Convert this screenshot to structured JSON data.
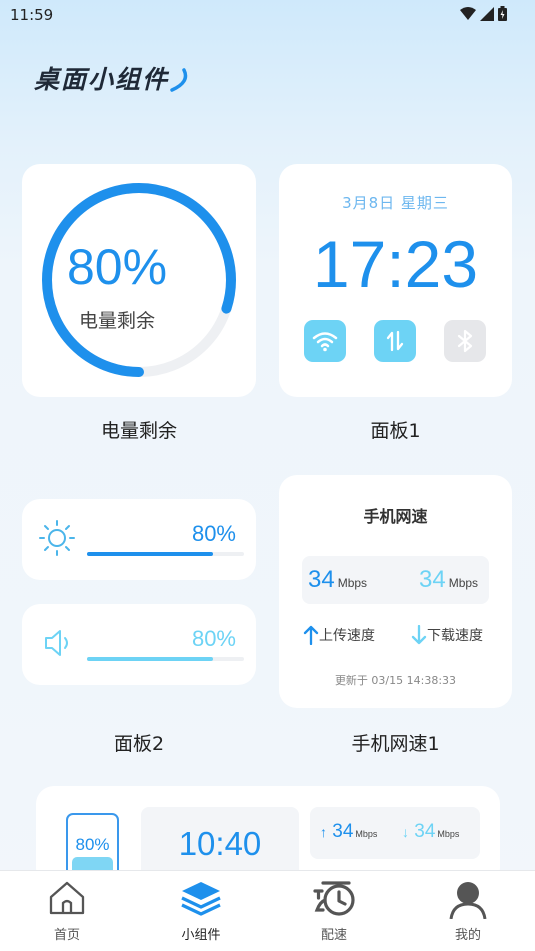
{
  "status_bar": {
    "time": "11:59"
  },
  "page": {
    "title": "桌面小组件"
  },
  "widgets": {
    "battery": {
      "percent_text": "80%",
      "percent_value": 80,
      "subtitle": "电量剩余",
      "caption": "电量剩余"
    },
    "panel1": {
      "date": "3月8日  星期三",
      "time": "17:23",
      "caption": "面板1"
    },
    "panel2": {
      "brightness": {
        "value_text": "80%",
        "level": 0.8
      },
      "volume": {
        "value_text": "80%",
        "level": 0.8
      },
      "caption": "面板2"
    },
    "network": {
      "title": "手机网速",
      "upload": {
        "value": "34",
        "unit": "Mbps",
        "label": "上传速度"
      },
      "download": {
        "value": "34",
        "unit": "Mbps",
        "label": "下载速度"
      },
      "updated": "更新于 03/15 14:38:33",
      "caption": "手机网速1"
    }
  },
  "preview": {
    "battery": "80%",
    "clock": "10:40",
    "upload": {
      "value": "34",
      "unit": "Mbps"
    },
    "download": {
      "value": "34",
      "unit": "Mbps"
    }
  },
  "nav": {
    "items": [
      {
        "label": "首页",
        "icon": "home-icon",
        "active": false
      },
      {
        "label": "小组件",
        "icon": "layers-icon",
        "active": true
      },
      {
        "label": "配速",
        "icon": "history-icon",
        "active": false
      },
      {
        "label": "我的",
        "icon": "profile-icon",
        "active": false
      }
    ]
  },
  "colors": {
    "accent": "#1e90ec",
    "accent_light": "#6dd3f5",
    "inactive": "#555555"
  }
}
